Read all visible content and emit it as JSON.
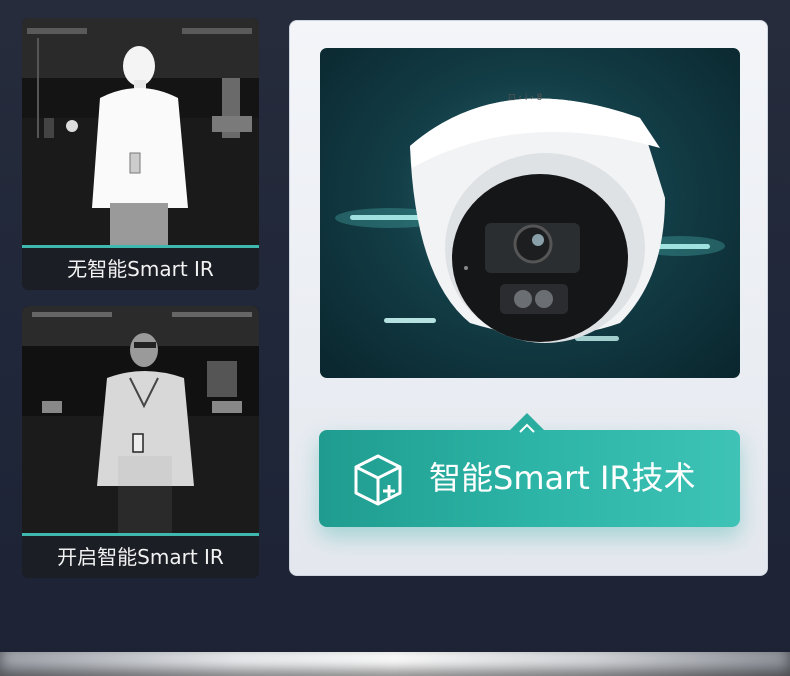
{
  "comparison": {
    "without": {
      "caption": "无智能Smart IR"
    },
    "with": {
      "caption": "开启智能Smart IR"
    }
  },
  "feature": {
    "title": "智能Smart IR技术",
    "icon": "box-plus-icon",
    "accent_color": "#2cb4a6"
  },
  "camera": {
    "product": "dome-camera-image"
  }
}
